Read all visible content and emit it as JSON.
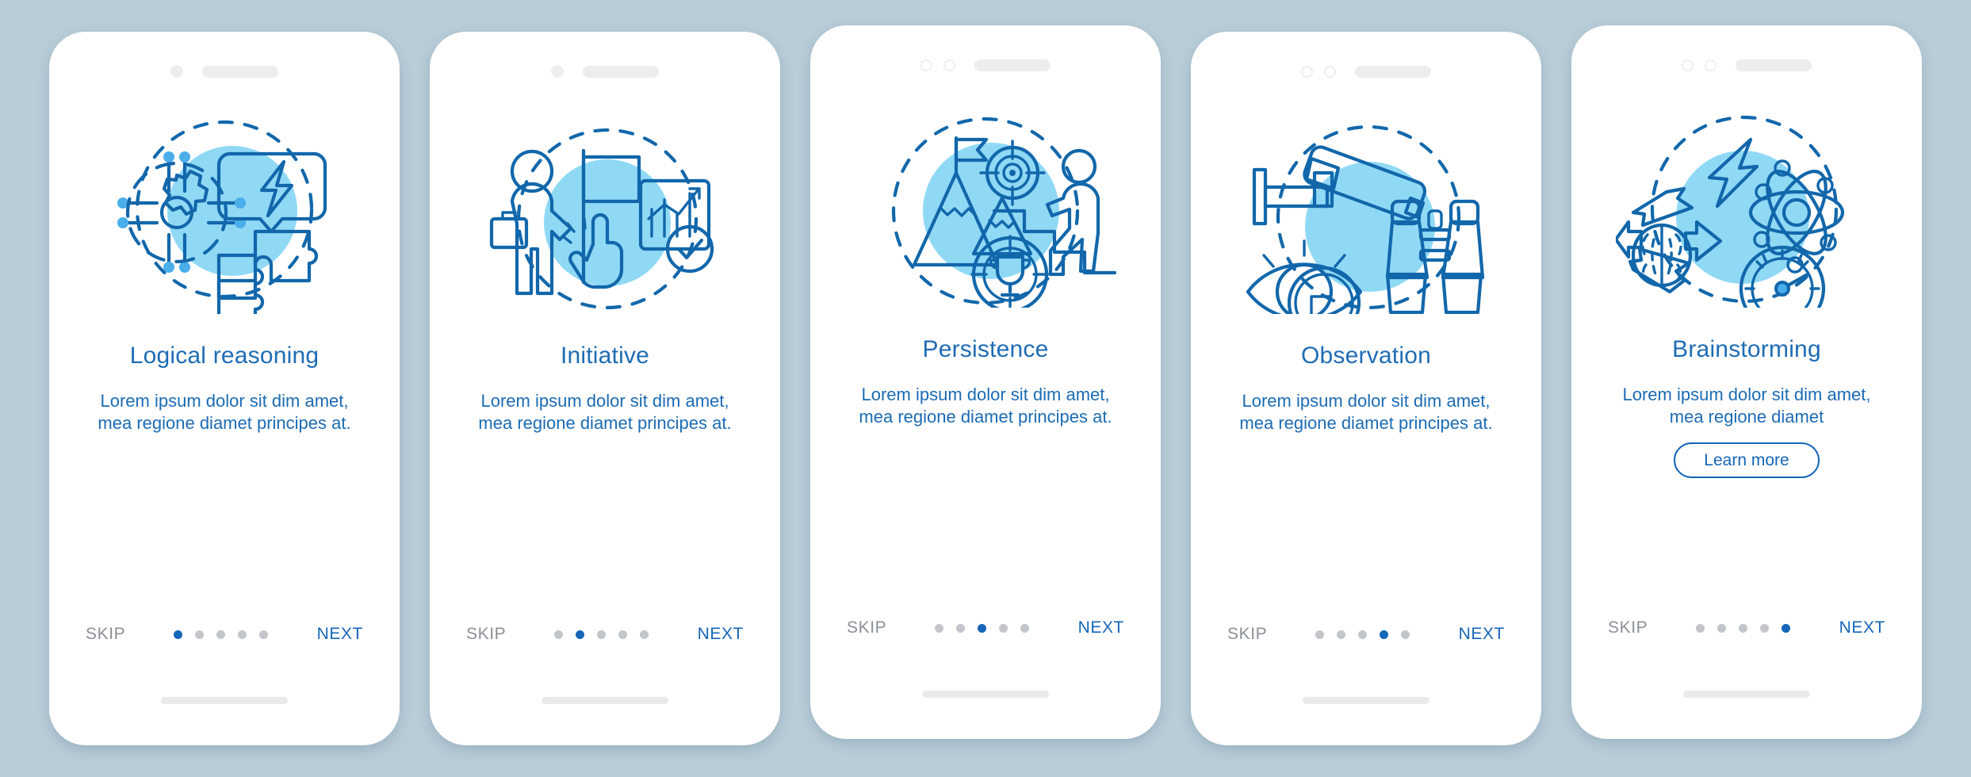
{
  "theme": {
    "background": "#b9cdd8",
    "card_background": "#ffffff",
    "accent_blue": "#1565b8",
    "title_blue": "#1f6cb5",
    "body_blue": "#1c6bb4",
    "muted_gray": "#8b9096",
    "dot_inactive": "#c2c6ca",
    "illustration_blob": "#8fd9f5",
    "illustration_line": "#1267ab",
    "illustration_fill": "#4aaeea"
  },
  "common": {
    "skip_label": "SKIP",
    "next_label": "NEXT",
    "total_steps": 5
  },
  "screens": [
    {
      "id": "logical-reasoning",
      "title": "Logical reasoning",
      "body": "Lorem ipsum dolor sit dim amet, mea regione diamet principes at.",
      "active_index": 0,
      "skip_label": "SKIP",
      "next_label": "NEXT",
      "has_learn_more": false,
      "learn_more_label": "",
      "notch_style": "single-dot",
      "illustration": "gear-network-lightbulb-puzzle-icon"
    },
    {
      "id": "initiative",
      "title": "Initiative",
      "body": "Lorem ipsum dolor sit dim amet, mea regione diamet principes at.",
      "active_index": 1,
      "skip_label": "SKIP",
      "next_label": "NEXT",
      "has_learn_more": false,
      "learn_more_label": "",
      "notch_style": "single-dot",
      "illustration": "person-flag-chart-checkmark-icon"
    },
    {
      "id": "persistence",
      "title": "Persistence",
      "body": "Lorem ipsum dolor sit dim amet, mea regione diamet principes at.",
      "active_index": 2,
      "skip_label": "SKIP",
      "next_label": "NEXT",
      "has_learn_more": false,
      "learn_more_label": "",
      "notch_style": "double-ring",
      "illustration": "mountain-target-stairs-trophy-icon"
    },
    {
      "id": "observation",
      "title": "Observation",
      "body": "Lorem ipsum dolor sit dim amet, mea regione diamet principes at.",
      "active_index": 3,
      "skip_label": "SKIP",
      "next_label": "NEXT",
      "has_learn_more": false,
      "learn_more_label": "",
      "notch_style": "double-ring",
      "illustration": "cctv-eye-magnifier-binoculars-icon"
    },
    {
      "id": "brainstorming",
      "title": "Brainstorming",
      "body": "Lorem ipsum dolor sit dim amet, mea regione diamet",
      "active_index": 4,
      "skip_label": "SKIP",
      "next_label": "NEXT",
      "has_learn_more": true,
      "learn_more_label": "Learn more",
      "notch_style": "double-ring",
      "illustration": "brain-arrows-atom-gauge-bolt-icon"
    }
  ]
}
